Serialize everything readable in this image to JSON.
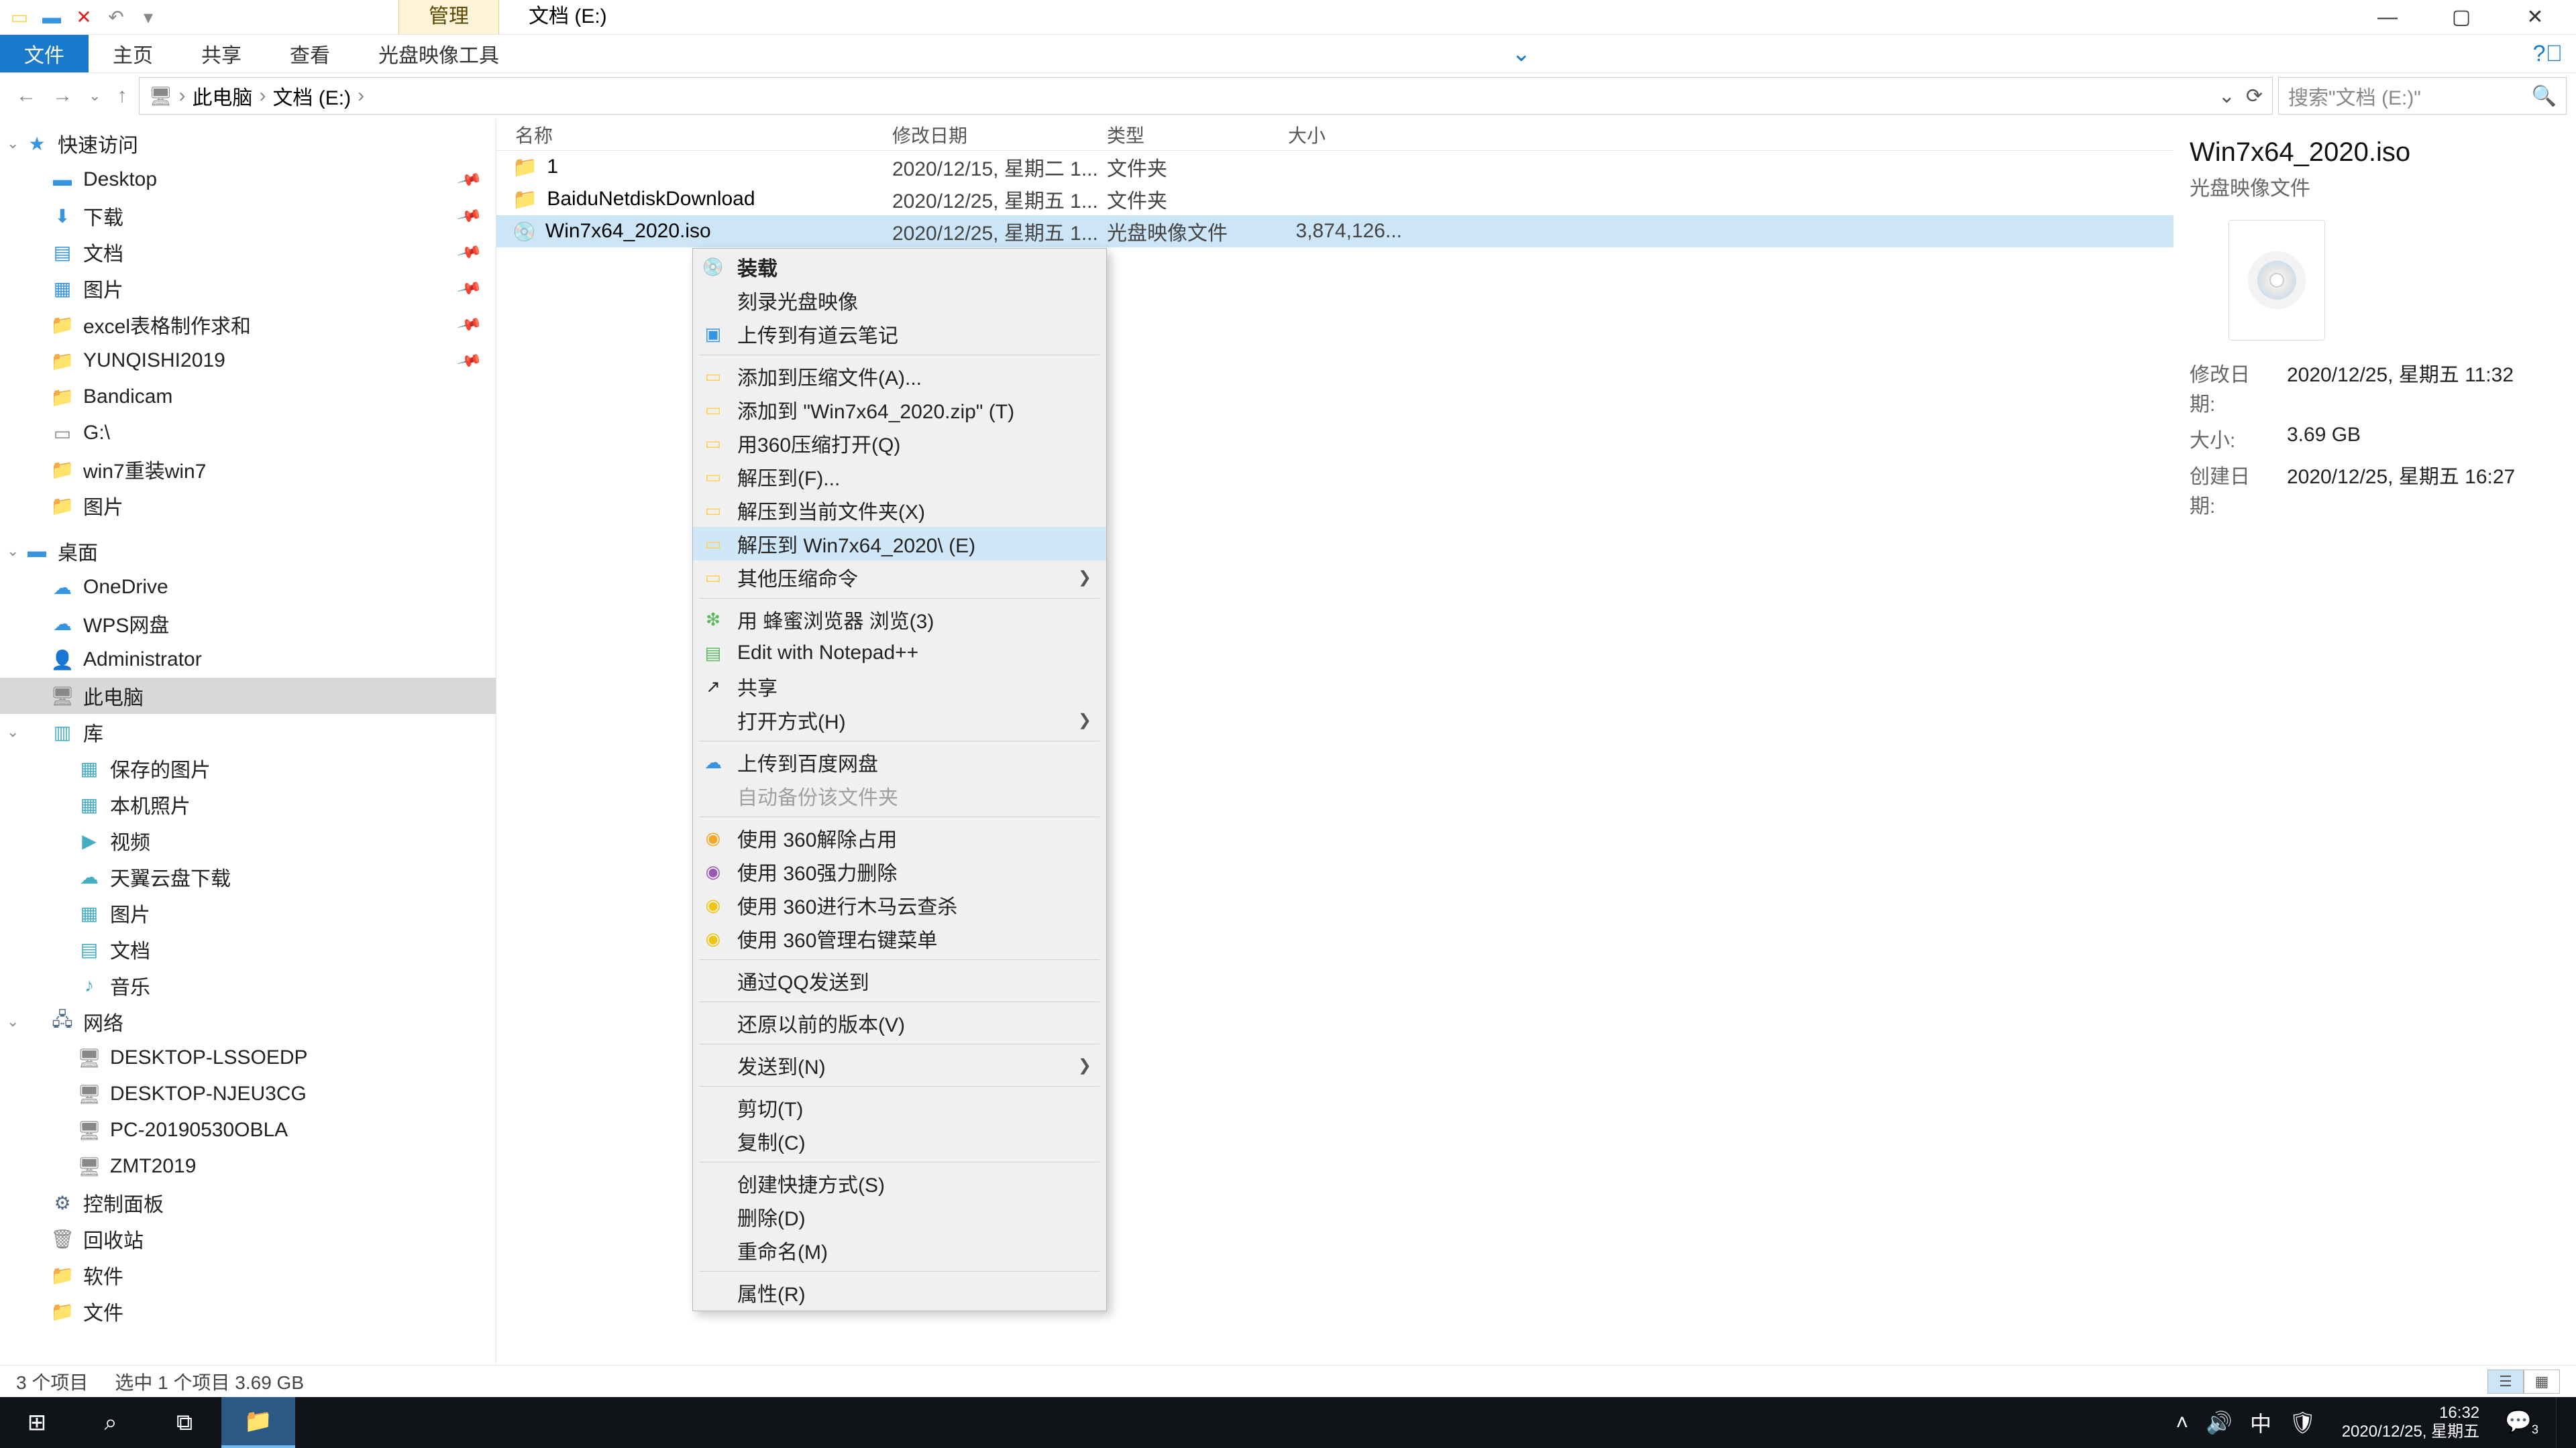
{
  "titlebar": {
    "contextual_tab": "管理",
    "window_title": "文档 (E:)"
  },
  "ribbon_tabs": {
    "file": "文件",
    "home": "主页",
    "share": "共享",
    "view": "查看",
    "tool": "光盘映像工具"
  },
  "address": {
    "root": "此电脑",
    "loc": "文档 (E:)"
  },
  "search": {
    "placeholder": "搜索\"文档 (E:)\""
  },
  "nav": {
    "quick": "快速访问",
    "quick_items": [
      "Desktop",
      "下载",
      "文档",
      "图片",
      "excel表格制作求和",
      "YUNQISHI2019",
      "Bandicam",
      "G:\\",
      "win7重装win7",
      "图片"
    ],
    "desktop_group": "桌面",
    "desktop_items": [
      "OneDrive",
      "WPS网盘",
      "Administrator",
      "此电脑",
      "库"
    ],
    "lib_items": [
      "保存的图片",
      "本机照片",
      "视频",
      "天翼云盘下载",
      "图片",
      "文档",
      "音乐"
    ],
    "network": "网络",
    "net_items": [
      "DESKTOP-LSSOEDP",
      "DESKTOP-NJEU3CG",
      "PC-20190530OBLA",
      "ZMT2019"
    ],
    "misc": [
      "控制面板",
      "回收站",
      "软件",
      "文件"
    ]
  },
  "columns": {
    "name": "名称",
    "date": "修改日期",
    "type": "类型",
    "size": "大小"
  },
  "files": [
    {
      "name": "1",
      "date": "2020/12/15, 星期二 1...",
      "type": "文件夹",
      "size": "",
      "kind": "folder"
    },
    {
      "name": "BaiduNetdiskDownload",
      "date": "2020/12/25, 星期五 1...",
      "type": "文件夹",
      "size": "",
      "kind": "folder"
    },
    {
      "name": "Win7x64_2020.iso",
      "date": "2020/12/25, 星期五 1...",
      "type": "光盘映像文件",
      "size": "3,874,126...",
      "kind": "iso",
      "selected": true
    }
  ],
  "ctx": {
    "mount": "装载",
    "burn": "刻录光盘映像",
    "youdao": "上传到有道云笔记",
    "add_archive": "添加到压缩文件(A)...",
    "add_zip": "添加到 \"Win7x64_2020.zip\" (T)",
    "open_360zip": "用360压缩打开(Q)",
    "extract_to": "解压到(F)...",
    "extract_here": "解压到当前文件夹(X)",
    "extract_folder": "解压到 Win7x64_2020\\ (E)",
    "other_zip": "其他压缩命令",
    "bee": "用 蜂蜜浏览器 浏览(3)",
    "npp": "Edit with Notepad++",
    "share": "共享",
    "openwith": "打开方式(H)",
    "baidu": "上传到百度网盘",
    "autobak": "自动备份该文件夹",
    "u360a": "使用 360解除占用",
    "u360b": "使用 360强力删除",
    "u360c": "使用 360进行木马云查杀",
    "u360d": "使用 360管理右键菜单",
    "qq": "通过QQ发送到",
    "restore": "还原以前的版本(V)",
    "sendto": "发送到(N)",
    "cut": "剪切(T)",
    "copy": "复制(C)",
    "shortcut": "创建快捷方式(S)",
    "delete": "删除(D)",
    "rename": "重命名(M)",
    "props": "属性(R)"
  },
  "details": {
    "title": "Win7x64_2020.iso",
    "subtitle": "光盘映像文件",
    "mod_k": "修改日期:",
    "mod_v": "2020/12/25, 星期五 11:32",
    "size_k": "大小:",
    "size_v": "3.69 GB",
    "cre_k": "创建日期:",
    "cre_v": "2020/12/25, 星期五 16:27"
  },
  "status": {
    "count": "3 个项目",
    "sel": "选中 1 个项目  3.69 GB"
  },
  "taskbar": {
    "time": "16:32",
    "date": "2020/12/25, 星期五",
    "ime": "中",
    "badge": "3"
  }
}
